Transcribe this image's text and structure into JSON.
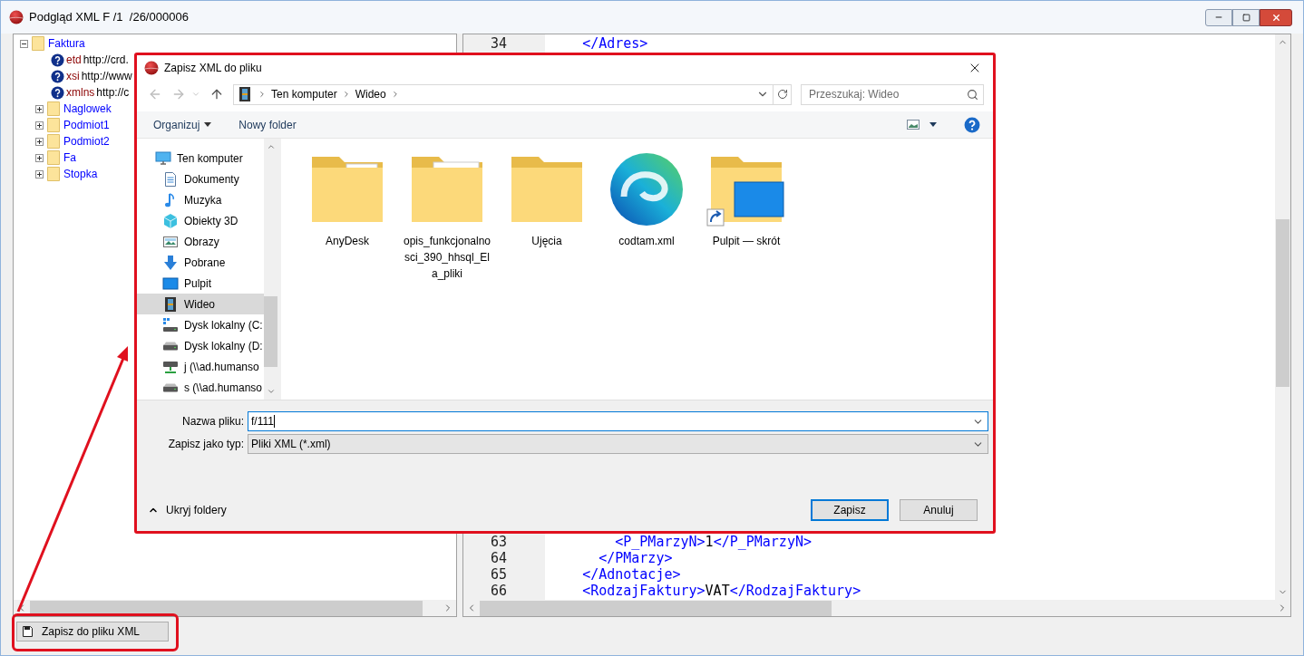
{
  "window": {
    "title": "Podgląd XML F /1  /26/000006"
  },
  "tree": [
    {
      "kind": "element",
      "label": "Faktura",
      "expanded": true,
      "children": [
        {
          "kind": "attribute",
          "name": "etd",
          "value": "http://crd."
        },
        {
          "kind": "attribute",
          "name": "xsi",
          "value": "http://www"
        },
        {
          "kind": "attribute",
          "name": "xmlns",
          "value": "http://c"
        },
        {
          "kind": "element",
          "label": "Naglowek",
          "expanded": false
        },
        {
          "kind": "element",
          "label": "Podmiot1",
          "expanded": false
        },
        {
          "kind": "element",
          "label": "Podmiot2",
          "expanded": false
        },
        {
          "kind": "element",
          "label": "Fa",
          "expanded": false
        },
        {
          "kind": "element",
          "label": "Stopka",
          "expanded": false
        }
      ]
    }
  ],
  "code": {
    "lines": [
      {
        "number": "34",
        "text": "    </Adres>"
      },
      {
        "number": "63",
        "text": "        <P_PMarzyN>1</P_PMarzyN>"
      },
      {
        "number": "64",
        "text": "      </PMarzy>"
      },
      {
        "number": "65",
        "text": "    </Adnotacje>"
      },
      {
        "number": "66",
        "text": "    <RodzajFaktury>VAT</RodzajFaktury>"
      }
    ]
  },
  "save_button": {
    "label": "Zapisz do pliku XML"
  },
  "dialog": {
    "title": "Zapisz XML do pliku",
    "breadcrumb": [
      "Ten komputer",
      "Wideo"
    ],
    "search": {
      "placeholder": "Przeszukaj: Wideo"
    },
    "toolbar": {
      "organize": "Organizuj",
      "new_folder": "Nowy folder"
    },
    "nav_pane": [
      {
        "label": "Ten komputer",
        "kind": "computer",
        "selected": false,
        "children": [
          {
            "label": "Dokumenty",
            "kind": "documents",
            "selected": false
          },
          {
            "label": "Muzyka",
            "kind": "music",
            "selected": false
          },
          {
            "label": "Obiekty 3D",
            "kind": "objects",
            "selected": false
          },
          {
            "label": "Obrazy",
            "kind": "pictures",
            "selected": false
          },
          {
            "label": "Pobrane",
            "kind": "downloads",
            "selected": false
          },
          {
            "label": "Pulpit",
            "kind": "desktop",
            "selected": false
          },
          {
            "label": "Wideo",
            "kind": "video",
            "selected": true
          },
          {
            "label": "Dysk lokalny (C:",
            "kind": "system_drive",
            "selected": false
          },
          {
            "label": "Dysk lokalny (D:",
            "kind": "drive",
            "selected": false
          },
          {
            "label": "j (\\\\ad.humanso",
            "kind": "network",
            "selected": false
          },
          {
            "label": "s (\\\\ad.humanso",
            "kind": "drive",
            "selected": false
          }
        ]
      }
    ],
    "files": [
      {
        "name": "AnyDesk",
        "kind": "documents"
      },
      {
        "name": "opis_funkcjonalnosci_390_hhsql_Ela_pliki",
        "kind": "app_folder"
      },
      {
        "name": "Ujęcia",
        "kind": "folder"
      },
      {
        "name": "codtam.xml",
        "kind": "file"
      },
      {
        "name": "Pulpit — skrót",
        "kind": "shortcut"
      }
    ],
    "file_name": {
      "label": "Nazwa pliku:",
      "value": "f/111"
    },
    "file_type": {
      "label": "Zapisz jako typ:",
      "value": "Pliki XML (*.xml)"
    },
    "hide_folders": "Ukryj foldery",
    "buttons": [
      {
        "label": "Zapisz",
        "default": true
      },
      {
        "label": "Anuluj",
        "default": false
      }
    ]
  }
}
